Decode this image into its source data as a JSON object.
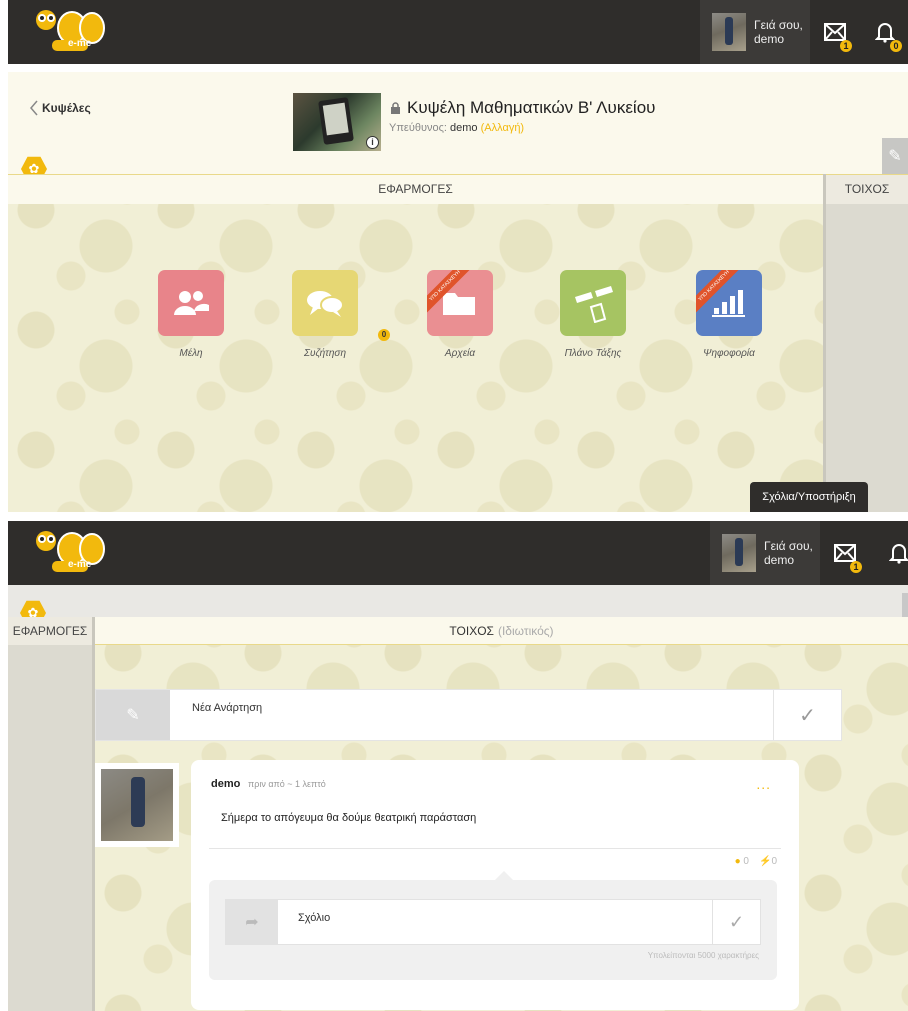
{
  "colors": {
    "topbar": "#2f2d2b",
    "accent": "#f2b90d",
    "members": "#e8848a",
    "discussion": "#e6d774",
    "files": "#ea8f92",
    "seating": "#a6c462",
    "poll": "#5a7fc4"
  },
  "topbar": {
    "greeting_line1": "Γειά σου,",
    "greeting_line2": "demo",
    "messages_badge": "1",
    "notifications_badge": "0",
    "logo_text": "e-me"
  },
  "hive": {
    "back_label": "Κυψέλες",
    "title": "Κυψέλη Μαθηματικών Β' Λυκείου",
    "owner_prefix": "Υπεύθυνος:",
    "owner_name": "demo",
    "change_label": "(Αλλαγή)",
    "info_icon": "i"
  },
  "apps_panel": {
    "header": "ΕΦΑΡΜΟΓΕΣ",
    "wall_header": "ΤΟΙΧΟΣ",
    "items": [
      {
        "label": "Μέλη",
        "icon": "members-icon"
      },
      {
        "label": "Συζήτηση",
        "icon": "chat-icon",
        "badge": "0"
      },
      {
        "label": "Αρχεία",
        "icon": "folder-icon",
        "ribbon": "ΥΠΟ ΚΑΤΑΣΚΕΥΗ"
      },
      {
        "label": "Πλάνο Τάξης",
        "icon": "seating-icon"
      },
      {
        "label": "Ψηφοφορία",
        "icon": "poll-icon",
        "ribbon": "ΥΠΟ ΚΑΤΑΣΚΕΥΗ"
      }
    ],
    "support_label": "Σχόλια/Υποστήριξη"
  },
  "wall": {
    "side_header": "ΕΦΑΡΜΟΓΕΣ",
    "header": "ΤΟΙΧΟΣ",
    "header_privacy": "(Ιδιωτικός)",
    "new_post_placeholder": "Νέα Ανάρτηση",
    "post": {
      "author": "demo",
      "time": "πριν από ~ 1 λεπτό",
      "text": "Σήμερα το απόγευμα θα δούμε θεατρική παράσταση",
      "menu": "...",
      "comments_count": "0",
      "likes_count": "0"
    },
    "comment_placeholder": "Σχόλιο",
    "remaining_chars": "Υπολείπονται 5000 χαρακτήρες"
  }
}
